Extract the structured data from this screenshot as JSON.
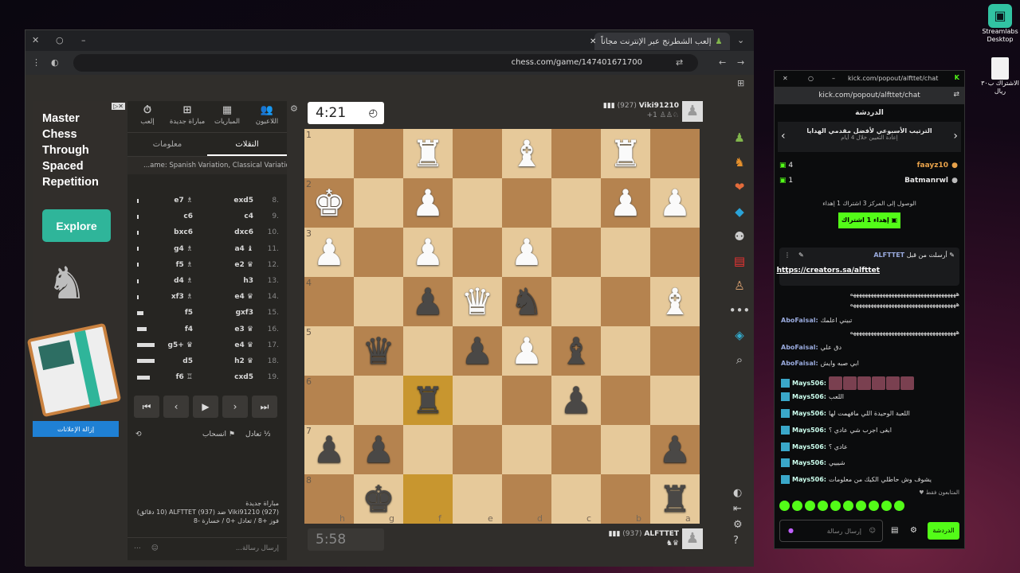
{
  "desktop": {
    "app_label": "Streamlabs\nDesktop",
    "file_label": "الاشتراك ب٣٠ ريال"
  },
  "browser": {
    "tab_title": "إلعب الشطرنج عبر الإنترنت مجاناً",
    "url": "chess.com/game/147401671700"
  },
  "ad": {
    "headline": [
      "Master",
      "Chess",
      "Through",
      "Spaced",
      "Repetition"
    ],
    "cta": "Explore",
    "remove_ads": "إزالة الإعلانات"
  },
  "panel": {
    "top_tabs": [
      {
        "icon": "⏱",
        "label": "إلعب"
      },
      {
        "icon": "⊞",
        "label": "مباراة جديدة"
      },
      {
        "icon": "▦",
        "label": "المباريات"
      },
      {
        "icon": "👥",
        "label": "اللاعبون"
      }
    ],
    "tabs": [
      "النقلات",
      "معلومات"
    ],
    "opening": "...ame: Spanish Variation, Classical Variation",
    "moves": [
      {
        "n": "8.",
        "w": "exd5",
        "b": "e7 ♗"
      },
      {
        "n": "9.",
        "w": "c4",
        "b": "c6"
      },
      {
        "n": "10.",
        "w": "dxc6",
        "b": "bxc6"
      },
      {
        "n": "11.",
        "w": "a4 ♝",
        "b": "g4 ♗"
      },
      {
        "n": "12.",
        "w": "e2 ♛",
        "b": "f5 ♗"
      },
      {
        "n": "13.",
        "w": "h3",
        "b": "d4 ♗"
      },
      {
        "n": "14.",
        "w": "e4 ♛",
        "b": "xf3 ♗"
      },
      {
        "n": "15.",
        "w": "gxf3",
        "b": "f5"
      },
      {
        "n": "16.",
        "w": "e3 ♛",
        "b": "f4"
      },
      {
        "n": "17.",
        "w": "e4 ♛",
        "b": "g5+ ♛"
      },
      {
        "n": "18.",
        "w": "h2 ♛",
        "b": "d5"
      },
      {
        "n": "19.",
        "w": "cxd5",
        "b": "f6 ♖"
      }
    ],
    "draw": "تعادل",
    "resign": "انسحاب",
    "game_info": [
      "مباراة جديدة",
      "Viki91210 (927) ضد ALFTTET (937) (10 دقائق)",
      "فوز +8 / تعادل +0 / خسارة -8"
    ],
    "message_placeholder": "إرسال رسالة..."
  },
  "board": {
    "ranks": [
      "1",
      "2",
      "3",
      "4",
      "5",
      "6",
      "7",
      "8"
    ],
    "files": [
      "h",
      "g",
      "f",
      "e",
      "d",
      "c",
      "b",
      "a"
    ],
    "top_player": {
      "name": "Viki91210",
      "rating": "(927)",
      "time": "4:21",
      "extra": "+1"
    },
    "bottom_player": {
      "name": "ALFTTET",
      "rating": "(937)",
      "time": "5:58"
    }
  },
  "chat": {
    "url": "kick.com/popout/alfttet/chat",
    "title": "الدردشة",
    "leaderboard_title": "الترتيب الأسبوعي لأفضل مقدمي الهدايا",
    "leaderboard_sub": "إعادة التعيين خلال 4 أيام",
    "leaders": [
      {
        "name": "faayz10",
        "count": "4"
      },
      {
        "name": "Batmanrwl",
        "count": "1"
      }
    ],
    "goal": "الوصول إلى المركز 3 اشتراك 1 إهداء",
    "gift_btn": "إهداء 1 اشتراك",
    "pinned_by": "ALFTTET",
    "pinned_label": "أرسلت من قبل",
    "pinned_link": "https://creators.sa/alfttet",
    "messages": [
      {
        "user": "",
        "text": "ههههههههههههههههههههههههههههههههههههه"
      },
      {
        "user": "",
        "text": "ههههههههههههههههههههههههههههههههههههه"
      },
      {
        "user": "AboFaisal",
        "text": "تبيني اعلمك"
      },
      {
        "user": "",
        "text": "ههههههههههههههههههههههههههههههههههههه"
      },
      {
        "user": "AboFaisal",
        "text": "دق علي"
      },
      {
        "user": "AboFaisal",
        "text": "ابي صبه وايش"
      },
      {
        "user": "Mays506",
        "text": ""
      },
      {
        "user": "Mays506",
        "text": "اللعب"
      },
      {
        "user": "Mays506",
        "text": "اللعبة الوحيدة اللي مافهمت لها"
      },
      {
        "user": "Mays506",
        "text": "ابغى اجرب شي عادي ؟"
      },
      {
        "user": "Mays506",
        "text": "عادي ؟"
      },
      {
        "user": "Mays506",
        "text": "شيييي"
      },
      {
        "user": "Mays506",
        "text": "يشوف وش حاطلي الكيك من معلومات"
      }
    ],
    "supporters": "المتابعون فقط",
    "input_placeholder": "إرسال رسالة",
    "send_btn": "الدردشة"
  }
}
